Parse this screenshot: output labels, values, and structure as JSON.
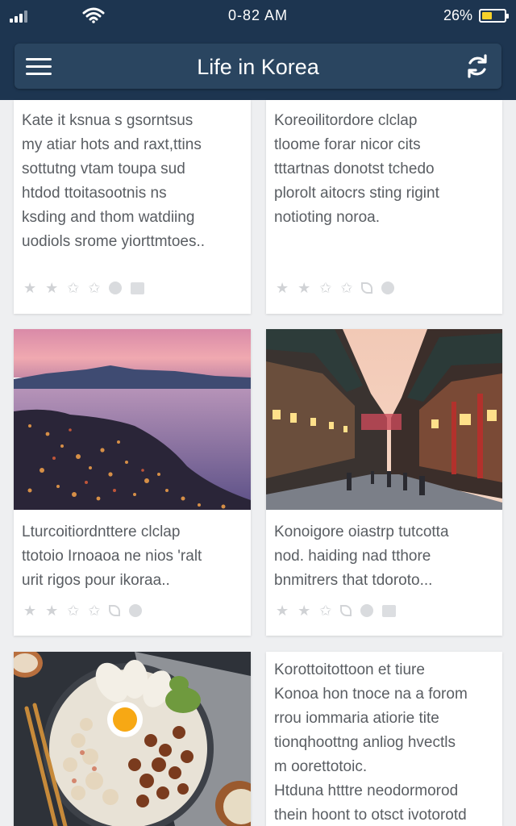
{
  "status_bar": {
    "time": "0-82 AM",
    "battery_pct": "26%"
  },
  "header": {
    "title": "Life in Korea",
    "menu_icon": "hamburger-menu-icon",
    "refresh_icon": "refresh-icon"
  },
  "colors": {
    "header_bg": "#1d3550",
    "appbar_bg": "#2a4560",
    "page_bg": "#eeeff1",
    "card_bg": "#ffffff",
    "text": "#595d62",
    "icon_muted": "#d0d2d5"
  },
  "cards": [
    {
      "text": "Kate it ksnua s gsorntsus\nmy atiar hots and raxt,ttins\nsottutng vtam toupa sud\nhtdod ttoitasootnis ns\nksding and thom watdiing\nuodiols srome yiorttmtoes.."
    },
    {
      "text": "Koreoilitordore clclap\ntloome forar nicor cits\ntttartnas donotst tchedo\nplorolt aitocrs sting rigint\nnotioting noroa."
    },
    {
      "image": "night-coastal-city-photo",
      "text": "Lturcoitiordnttere clclap\nttotoio Irnoaoa ne nios 'ralt\nurit rigos pour ikoraa.."
    },
    {
      "image": "hanok-street-photo",
      "text": "Konoigore oiastrp tutcotta\nnod. haiding nad tthore\nbnmitrers that tdoroto..."
    },
    {
      "image": "bibimbap-bowl-photo"
    },
    {
      "text": "Korottoitottoon et tiure\nKonoa hon tnoce na a forom\nrrou iommaria atiorie tite\ntionqhoottng anliog hvectls\nm oorettotoic.\nHtduna htttre neodormorod\nthein hoont to otsct ivotorotd"
    }
  ]
}
